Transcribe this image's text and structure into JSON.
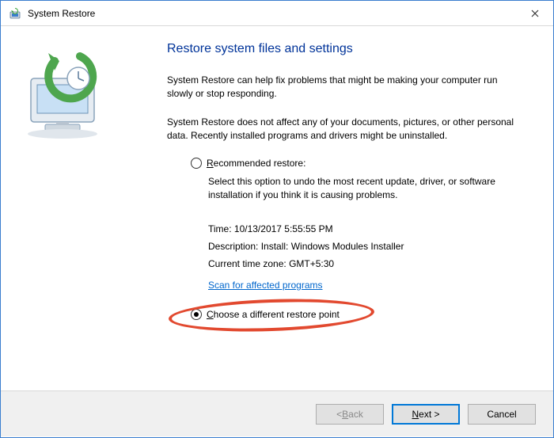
{
  "titlebar": {
    "title": "System Restore"
  },
  "main": {
    "heading": "Restore system files and settings",
    "para1": "System Restore can help fix problems that might be making your computer run slowly or stop responding.",
    "para2": "System Restore does not affect any of your documents, pictures, or other personal data. Recently installed programs and drivers might be uninstalled."
  },
  "options": {
    "recommended": {
      "label_pre": "R",
      "label_rest": "ecommended restore:",
      "selected": false,
      "desc": "Select this option to undo the most recent update, driver, or software installation if you think it is causing problems.",
      "time_label": "Time:",
      "time_value": "10/13/2017 5:55:55 PM",
      "desc_label": "Description:",
      "desc_value": "Install: Windows Modules Installer",
      "tz_label": "Current time zone:",
      "tz_value": "GMT+5:30",
      "scan_link": "Scan for affected programs"
    },
    "different": {
      "label_pre": "C",
      "label_rest": "hoose a different restore point",
      "selected": true
    }
  },
  "buttons": {
    "back_pre": "< ",
    "back_u": "B",
    "back_rest": "ack",
    "next_u": "N",
    "next_rest": "ext >",
    "cancel": "Cancel"
  }
}
